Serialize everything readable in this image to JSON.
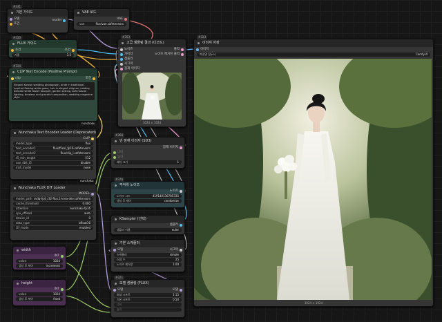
{
  "badges": {
    "n1": "#331",
    "n2": "#333",
    "n3": "#334",
    "n4": "#353",
    "n5": "#368",
    "n6": "#376",
    "n7": "#321",
    "n8": "#323",
    "n9": "#325",
    "n10": "#330",
    "n11": "#327",
    "n12": "#329",
    "n13": "#328",
    "n14": "#326",
    "n15": "#332"
  },
  "nodes": {
    "model_loader": {
      "title": "기본 가이드",
      "in1": "모델",
      "in2": "조건",
      "out": "model"
    },
    "vae": {
      "title": "VAE 로드",
      "out": "VAE",
      "field_label": "vae",
      "field_value": "flux/vae.safetensors"
    },
    "flux_guide": {
      "title": "FLUX 가이드",
      "in": "조건",
      "out": "조건",
      "field_label": "가중",
      "field_value": "3.5"
    },
    "clip_encode": {
      "title": "CLIP Text Encode (Positive Prompt)",
      "in": "clip",
      "out": "조건",
      "prompt": "Elegant Korean wedding photograph, bride in traditional-inspired flowing white gown, hair in elegant chignon, holding delicate white flower bouquet, garden setting, soft natural lighting, timeless and graceful composition, wedding magazine style",
      "footer": "nunchaku"
    },
    "vae_decode": {
      "title": "고급 샘플링 결과 (디코드)",
      "in1": "노이즈",
      "in2": "가이더",
      "in3": "샘플러",
      "in4": "시그마",
      "in5": "잠재 이미지",
      "out1": "출력",
      "out2": "노이즈 제거된 출력",
      "footer": "1024 × 1024"
    },
    "text_encoder": {
      "title": "Nunchaku Text Encoder Loader (Deprecated)",
      "out": "CLIP",
      "footer": "nunchaku",
      "fields": [
        {
          "label": "model_type",
          "value": "flux"
        },
        {
          "label": "text_encoder1",
          "value": "flux/t5xxl_fp16.safetensors"
        },
        {
          "label": "text_encoder2",
          "value": "flux/clip_l.safetensors"
        },
        {
          "label": "t5_min_length",
          "value": "512"
        },
        {
          "label": "use_4bit_t5",
          "value": "disable"
        },
        {
          "label": "int4_model",
          "value": "none"
        }
      ]
    },
    "dit_loader": {
      "title": "Nunchaku FLUX DiT Loader",
      "out": "MODEL",
      "fields": [
        {
          "label": "model_path",
          "value": "svdq-fp4_r32-flux.1-krea-dev.safetensors"
        },
        {
          "label": "cache_threshold",
          "value": "0.000"
        },
        {
          "label": "attention",
          "value": "nunchaku-fp16"
        },
        {
          "label": "cpu_offload",
          "value": "auto"
        },
        {
          "label": "device_id",
          "value": "0"
        },
        {
          "label": "data_type",
          "value": "bfloat16"
        },
        {
          "label": "i2f_mode",
          "value": "enabled"
        }
      ]
    },
    "latent": {
      "title": "빈 잠재 이미지 (SD3)",
      "in1": "너비",
      "in2": "높이",
      "out": "잠재 이미지",
      "field_label": "배치 크기",
      "field_value": "1"
    },
    "noise": {
      "title": "무작위 노이즈",
      "out": "노이즈",
      "f1_label": "노이즈 시드",
      "f1_value": "419140136785335",
      "f2_label": "생성 후 제어",
      "f2_value": "randomize"
    },
    "ksampler": {
      "title": "KSampler (선택)",
      "out": "샘플러",
      "field_label": "샘플러 이름",
      "field_value": "euler"
    },
    "scheduler": {
      "title": "기본 스케줄러",
      "in": "모델",
      "out": "시그마",
      "fields": [
        {
          "label": "스케줄러",
          "value": "simple"
        },
        {
          "label": "스텝 수",
          "value": "25"
        },
        {
          "label": "노이즈 제거양",
          "value": "1.00"
        }
      ]
    },
    "width": {
      "title": "width",
      "out": "INT",
      "f1_label": "value",
      "f1_value": "1024",
      "f2_label": "생성 후 제어",
      "f2_value": "increment"
    },
    "height": {
      "title": "height",
      "out": "INT",
      "f1_label": "value",
      "f1_value": "1024",
      "f2_label": "생성 후 제어",
      "f2_value": "fixed"
    },
    "model_sampling": {
      "title": "모델 샘플링 (FLUX)",
      "in": "모델",
      "out": "모델",
      "fields": [
        {
          "label": "최대 시프트",
          "value": "1.15"
        },
        {
          "label": "기본 시프트",
          "value": "0.50"
        },
        {
          "label": "너비",
          "value": ""
        },
        {
          "label": "높이",
          "value": ""
        }
      ]
    },
    "save_image": {
      "title": "이미지 저장",
      "in": "이미지",
      "field_label": "파일명 접두사",
      "field_value": "ComfyUI",
      "footer": "1024 × 1024"
    }
  },
  "colors": {
    "link_conditioning": "#f2b43a",
    "link_model": "#b39ddb",
    "link_clip": "#f6d25a",
    "link_vae": "#e57373",
    "link_latent": "#ef9bd0",
    "link_image": "#64b5f6",
    "link_int": "#9ccc65",
    "link_noise": "#cfcfcf",
    "link_sampler": "#4fc3f7"
  }
}
